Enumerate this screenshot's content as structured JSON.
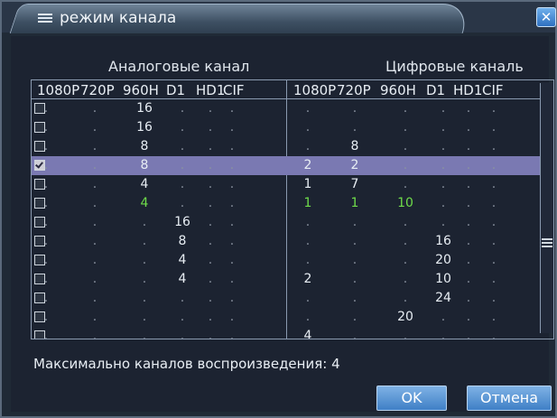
{
  "window": {
    "title": "режим канала",
    "close_symbol": "✕"
  },
  "headers": {
    "analog": "Аналоговые канал",
    "digital": "Цифровые каналь"
  },
  "columns": [
    "1080P",
    "720P",
    "960H",
    "D1",
    "HD1",
    "CIF",
    "1080P",
    "720P",
    "960H",
    "D1",
    "HD1",
    "CIF"
  ],
  "rows": [
    {
      "checked": false,
      "selected": false,
      "values": [
        ".",
        ".",
        "16",
        ".",
        ".",
        ".",
        ".",
        ".",
        ".",
        ".",
        ".",
        "."
      ],
      "green": []
    },
    {
      "checked": false,
      "selected": false,
      "values": [
        ".",
        ".",
        "16",
        ".",
        ".",
        ".",
        ".",
        ".",
        ".",
        ".",
        ".",
        "."
      ],
      "green": []
    },
    {
      "checked": false,
      "selected": false,
      "values": [
        ".",
        ".",
        "8",
        ".",
        ".",
        ".",
        ".",
        "8",
        ".",
        ".",
        ".",
        "."
      ],
      "green": []
    },
    {
      "checked": true,
      "selected": true,
      "values": [
        ".",
        ".",
        "8",
        ".",
        ".",
        ".",
        "2",
        "2",
        ".",
        ".",
        ".",
        "."
      ],
      "green": []
    },
    {
      "checked": false,
      "selected": false,
      "values": [
        ".",
        ".",
        "4",
        ".",
        ".",
        ".",
        "1",
        "7",
        ".",
        ".",
        ".",
        "."
      ],
      "green": []
    },
    {
      "checked": false,
      "selected": false,
      "values": [
        ".",
        ".",
        "4",
        ".",
        ".",
        ".",
        "1",
        "1",
        "10",
        ".",
        ".",
        "."
      ],
      "green": [
        2,
        6,
        7,
        8
      ]
    },
    {
      "checked": false,
      "selected": false,
      "values": [
        ".",
        ".",
        ".",
        "16",
        ".",
        ".",
        ".",
        ".",
        ".",
        ".",
        ".",
        "."
      ],
      "green": []
    },
    {
      "checked": false,
      "selected": false,
      "values": [
        ".",
        ".",
        ".",
        "8",
        ".",
        ".",
        ".",
        ".",
        ".",
        "16",
        ".",
        "."
      ],
      "green": []
    },
    {
      "checked": false,
      "selected": false,
      "values": [
        ".",
        ".",
        ".",
        "4",
        ".",
        ".",
        ".",
        ".",
        ".",
        "20",
        ".",
        "."
      ],
      "green": []
    },
    {
      "checked": false,
      "selected": false,
      "values": [
        ".",
        ".",
        ".",
        "4",
        ".",
        ".",
        "2",
        ".",
        ".",
        "10",
        ".",
        "."
      ],
      "green": []
    },
    {
      "checked": false,
      "selected": false,
      "values": [
        ".",
        ".",
        ".",
        ".",
        ".",
        ".",
        ".",
        ".",
        ".",
        "24",
        ".",
        "."
      ],
      "green": []
    },
    {
      "checked": false,
      "selected": false,
      "values": [
        ".",
        ".",
        ".",
        ".",
        ".",
        ".",
        ".",
        ".",
        "20",
        ".",
        ".",
        "."
      ],
      "green": []
    },
    {
      "checked": false,
      "selected": false,
      "values": [
        ".",
        ".",
        ".",
        ".",
        ".",
        ".",
        "4",
        ".",
        ".",
        ".",
        ".",
        "."
      ],
      "green": []
    }
  ],
  "footer": {
    "max_channels": "Максимально каналов воспроизведения: 4"
  },
  "buttons": {
    "ok": "OK",
    "cancel": "Отмена"
  },
  "colors": {
    "selected_row": "#7a79b2",
    "green_value": "#6fdc4a",
    "button": "#5a96d6"
  }
}
